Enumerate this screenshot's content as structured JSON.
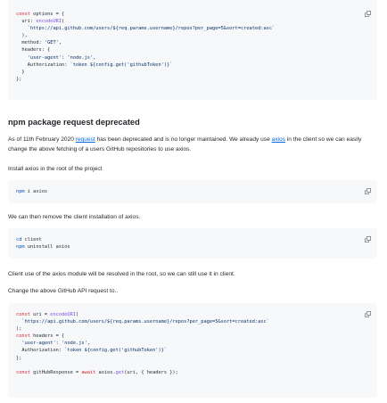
{
  "blocks": {
    "code1": [
      "const options = {",
      "  uri: encodeURI(",
      "    `https://api.github.com/users/${req.params.username}/repos?per_page=5&sort=created:asc`",
      "  ),",
      "  method: 'GET',",
      "  headers: {",
      "    'user-agent': 'node.js',",
      "    Authorization: `token ${config.get('githubToken')}`",
      "  }",
      "};"
    ],
    "heading": "npm package request deprecated",
    "para1_before": "As of 11th February 2020 ",
    "para1_link1": "request",
    "para1_mid": " has been deprecated and is no longer maintained. We already use ",
    "para1_link2": "axios",
    "para1_after": " in the client so we can easily change the above fetching of a users GitHub repositories to use axios.",
    "para2": "Install axios in the root of the project",
    "code2": [
      "npm i axios"
    ],
    "para3": "We can then remove the client installation of axios.",
    "code3": [
      "cd client",
      "npm uninstall axios"
    ],
    "para4": "Client use of the axios module will be resolved in the root, so we can still use it in client.",
    "para5": "Change the above GitHub API request to..",
    "code4": [
      "const uri = encodeURI(",
      "  `https://api.github.com/users/${req.params.username}/repos?per_page=5&sort=created:asc`",
      ");",
      "const headers = {",
      "  'user-agent': 'node.js',",
      "  Authorization: `token ${config.get('githubToken')}`",
      "};",
      "",
      "const gitHubResponse = await axios.get(uri, { headers });"
    ]
  },
  "icons": {
    "copy": "copy-icon"
  },
  "colors": {
    "code_bg": "#f6f8fa",
    "link": "#0969da",
    "keyword": "#cf222e",
    "string": "#0a3069"
  }
}
